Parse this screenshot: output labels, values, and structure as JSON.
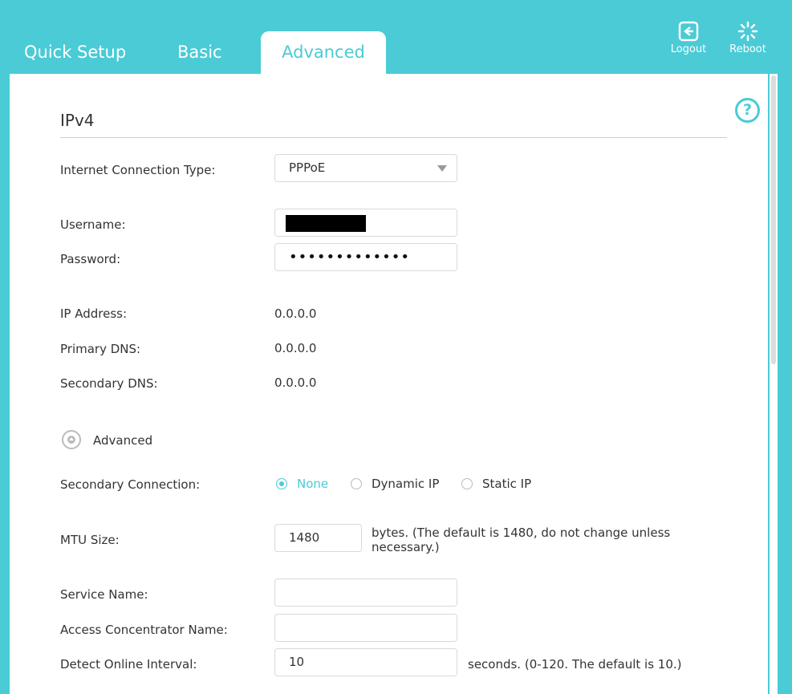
{
  "nav": {
    "tabs": [
      {
        "label": "Quick Setup"
      },
      {
        "label": "Basic"
      },
      {
        "label": "Advanced"
      }
    ],
    "logout_label": "Logout",
    "reboot_label": "Reboot"
  },
  "section_title": "IPv4",
  "form": {
    "connection_type_label": "Internet Connection Type:",
    "connection_type_value": "PPPoE",
    "username_label": "Username:",
    "password_label": "Password:",
    "password_mask": "•••••••••••••",
    "ip_address_label": "IP Address:",
    "ip_address_value": "0.0.0.0",
    "primary_dns_label": "Primary DNS:",
    "primary_dns_value": "0.0.0.0",
    "secondary_dns_label": "Secondary DNS:",
    "secondary_dns_value": "0.0.0.0",
    "advanced_toggle_label": "Advanced",
    "secondary_connection_label": "Secondary Connection:",
    "secondary_connection_options": [
      {
        "label": "None",
        "selected": true
      },
      {
        "label": "Dynamic IP",
        "selected": false
      },
      {
        "label": "Static IP",
        "selected": false
      }
    ],
    "mtu_label": "MTU Size:",
    "mtu_value": "1480",
    "mtu_note_line1": "bytes. (The default is 1480, do not change unless",
    "mtu_note_line2": "necessary.)",
    "service_name_label": "Service Name:",
    "service_name_value": "",
    "ac_name_label": "Access Concentrator Name:",
    "ac_name_value": "",
    "detect_interval_label": "Detect Online Interval:",
    "detect_interval_value": "10",
    "detect_interval_note": "seconds. (0-120. The default is 10.)"
  },
  "colors": {
    "accent": "#4acbd6",
    "background": "#ffffff"
  },
  "icons": {
    "logout": "logout-icon",
    "reboot": "reboot-icon",
    "help": "help-icon"
  }
}
